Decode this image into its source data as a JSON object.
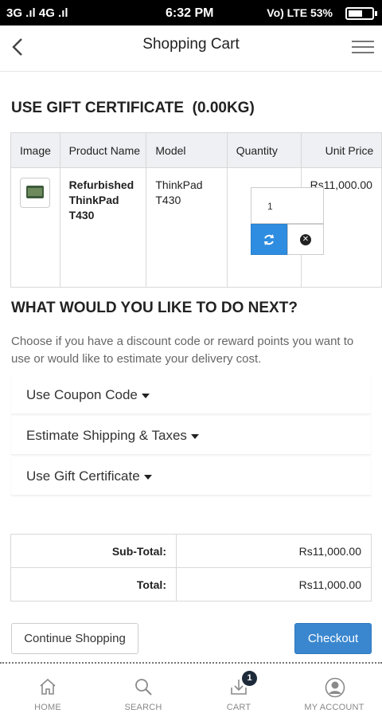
{
  "status_bar": {
    "left": "3G .ıl  4G .ıl",
    "time": "6:32 PM",
    "right": "Vo) LTE  53%"
  },
  "header": {
    "title": "Shopping Cart",
    "back_icon": "chevron-left-icon",
    "menu_icon": "hamburger-menu-icon"
  },
  "gift_section": {
    "title": "USE GIFT CERTIFICATE",
    "weight": "(0.00KG)"
  },
  "cart_table": {
    "columns": [
      "Image",
      "Product Name",
      "Model",
      "Quantity",
      "Unit Price"
    ],
    "rows": [
      {
        "product_name": "Refurbished ThinkPad T430",
        "model": "ThinkPad T430",
        "quantity": "1",
        "unit_price": "Rs11,000.00"
      }
    ],
    "update_icon": "refresh-icon",
    "remove_icon": "times-circle-icon"
  },
  "next_section": {
    "title": "WHAT WOULD YOU LIKE TO DO NEXT?",
    "description": "Choose if you have a discount code or reward points you want to use or would like to estimate your delivery cost.",
    "options": [
      {
        "label": "Use Coupon Code"
      },
      {
        "label": "Estimate Shipping & Taxes"
      },
      {
        "label": "Use Gift Certificate"
      }
    ]
  },
  "totals": {
    "rows": [
      {
        "label": "Sub-Total:",
        "value": "Rs11,000.00"
      },
      {
        "label": "Total:",
        "value": "Rs11,000.00"
      }
    ]
  },
  "actions": {
    "continue_label": "Continue Shopping",
    "checkout_label": "Checkout"
  },
  "tab_bar": {
    "items": [
      {
        "label": "HOME",
        "icon": "home-icon"
      },
      {
        "label": "SEARCH",
        "icon": "search-icon"
      },
      {
        "label": "CART",
        "icon": "download-tray-icon",
        "badge": "1"
      },
      {
        "label": "MY ACCOUNT",
        "icon": "user-circle-icon"
      }
    ]
  },
  "colors": {
    "accent": "#3a87cf",
    "update_button": "#2e8de0",
    "badge": "#1d2a3a"
  }
}
